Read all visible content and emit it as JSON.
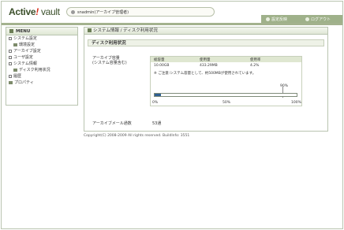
{
  "header": {
    "logo_main": "Active",
    "logo_bang": "!",
    "logo_suffix": " vault",
    "tenant": "snadmin(アーカイブ管理者)",
    "nav": [
      {
        "label": "設定反映",
        "icon": "refresh-icon"
      },
      {
        "label": "ログアウト",
        "icon": "logout-icon"
      }
    ]
  },
  "sidebar": {
    "title": "MENU",
    "items": [
      {
        "label": "システム設定",
        "level": 0
      },
      {
        "label": "環境設定",
        "level": 1
      },
      {
        "label": "アーカイブ設定",
        "level": 0
      },
      {
        "label": "ユーザ設定",
        "level": 0
      },
      {
        "label": "システム情報",
        "level": 0
      },
      {
        "label": "ディスク利用状況",
        "level": 1
      },
      {
        "label": "履歴",
        "level": 0
      },
      {
        "label": "プロパティ",
        "level": 0
      }
    ]
  },
  "main": {
    "breadcrumb": "システム情報 / ディスク利用状況",
    "section_title": "ディスク利用状況",
    "capacity_label_line1": "アーカイブ容量",
    "capacity_label_line2": "(システム容量含む)",
    "table": {
      "headers": [
        "総容量",
        "使用量",
        "使用率"
      ],
      "values": [
        "10.00GB",
        "433.29MB",
        "4.2%"
      ]
    },
    "note": "※ ご注意:システム容量として、約500MBが使用されています。",
    "gauge": {
      "percent": 4.2,
      "warning_label": "90%",
      "warning_percent": 90,
      "ticks": [
        "0%",
        "50%",
        "100%"
      ]
    },
    "mail_count_label": "アーカイブメール通数",
    "mail_count_value": "53通"
  },
  "footer": {
    "copyright": "Copyright(C) 2008-2009 All rights reserved. BuildInfo: 3551"
  },
  "colors": {
    "accent": "#a3b28e",
    "gauge_fill": "#2f5f91",
    "logo_bang": "#d9321f"
  }
}
